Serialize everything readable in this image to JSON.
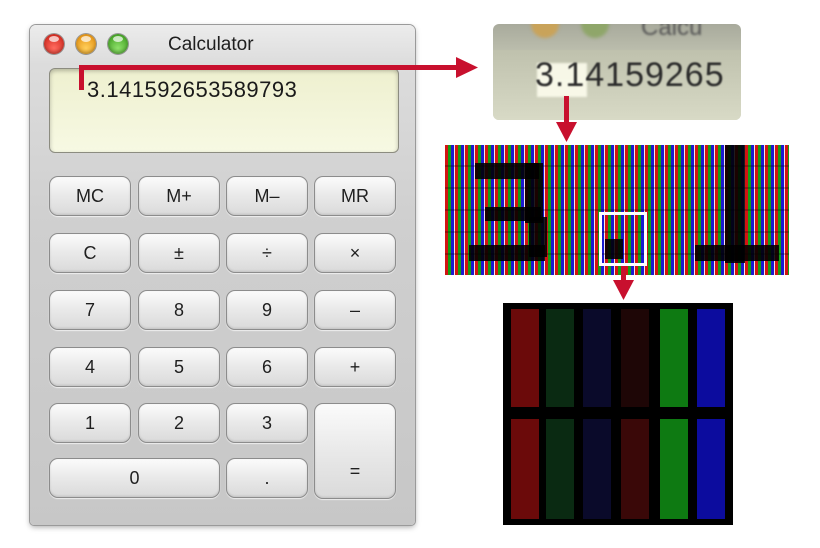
{
  "window": {
    "title": "Calculator",
    "controls": [
      "close",
      "minimize",
      "zoom"
    ]
  },
  "display": {
    "value": "3.141592653589793"
  },
  "buttons": [
    [
      "MC",
      "M+",
      "M–",
      "MR"
    ],
    [
      "C",
      "±",
      "÷",
      "×"
    ],
    [
      "7",
      "8",
      "9",
      "–"
    ],
    [
      "4",
      "5",
      "6",
      "+"
    ],
    [
      "1",
      "2",
      "3"
    ],
    [
      "0",
      "."
    ]
  ],
  "equals_label": "=",
  "zoom_view": {
    "partial_title": "Calcu",
    "digits": "3.14159265"
  },
  "colors": {
    "arrow": "#c8102e",
    "display_bg": "#f4f6dc",
    "subpixel_red": "#d21414",
    "subpixel_green": "#14a014",
    "subpixel_blue": "#1a1ad0"
  },
  "icons": [
    "close-icon",
    "minimize-icon",
    "zoom-icon",
    "arrow-right-icon",
    "arrow-down-icon"
  ]
}
